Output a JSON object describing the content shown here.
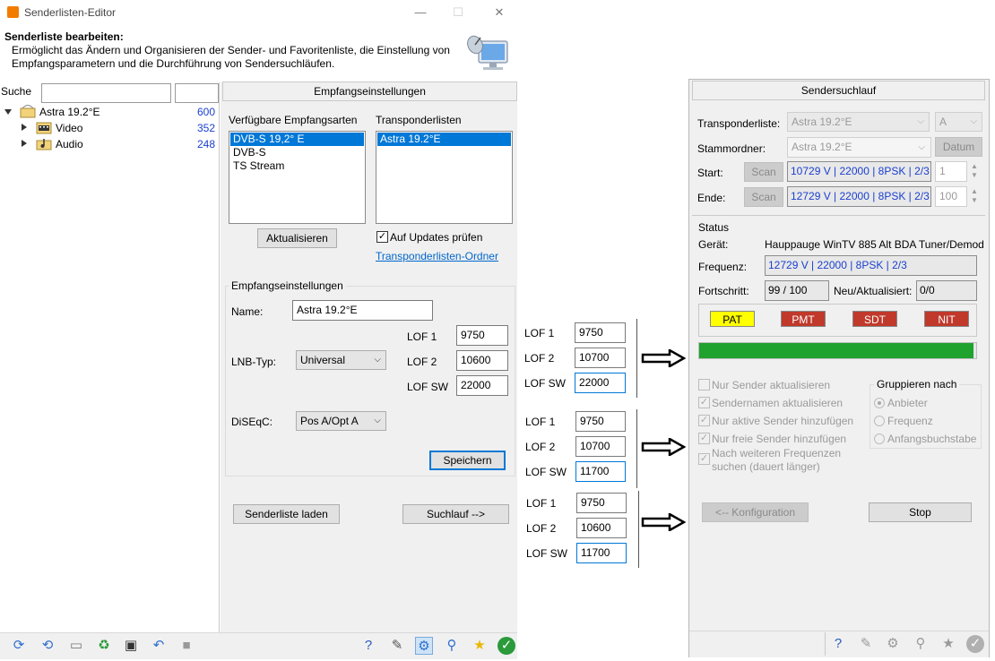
{
  "window": {
    "title": "Senderlisten-Editor",
    "minimize_glyph": "—",
    "maximize_glyph": "☐",
    "close_glyph": "✕",
    "header_title": "Senderliste bearbeiten:",
    "header_desc": "Ermöglicht das Ändern und Organisieren der Sender- und Favoritenliste, die Einstellung von Empfangsparametern und die Durchführung von Sendersuchläufen."
  },
  "left": {
    "search_label": "Suche",
    "tree": [
      {
        "label": "Astra 19.2°E",
        "count": "600"
      },
      {
        "label": "Video",
        "count": "352"
      },
      {
        "label": "Audio",
        "count": "248"
      }
    ]
  },
  "mid": {
    "panel_title": "Empfangseinstellungen",
    "available_label": "Verfügbare Empfangsarten",
    "available_items": [
      "DVB-S 19,2° E",
      "DVB-S",
      "TS Stream"
    ],
    "transponder_label": "Transponderlisten",
    "transponder_items": [
      "Astra 19.2°E"
    ],
    "refresh_button": "Aktualisieren",
    "updates_check": "Auf Updates prüfen",
    "folder_link": "Transponderlisten-Ordner",
    "group_title": "Empfangseinstellungen",
    "name_label": "Name:",
    "name_value": "Astra 19.2°E",
    "lnb_label": "LNB-Typ:",
    "lnb_value": "Universal",
    "lof1_label": "LOF 1",
    "lof1_value": "9750",
    "lof2_label": "LOF 2",
    "lof2_value": "10600",
    "lofsw_label": "LOF SW",
    "lofsw_value": "22000",
    "diseqc_label": "DiSEqC:",
    "diseqc_value": "Pos A/Opt A",
    "save_button": "Speichern",
    "load_button": "Senderliste laden",
    "scan_button": "Suchlauf -->"
  },
  "lof_panels": [
    {
      "lof1_label": "LOF 1",
      "lof1": "9750",
      "lof2_label": "LOF 2",
      "lof2": "10700",
      "lofsw_label": "LOF SW",
      "lofsw": "22000"
    },
    {
      "lof1_label": "LOF 1",
      "lof1": "9750",
      "lof2_label": "LOF 2",
      "lof2": "10700",
      "lofsw_label": "LOF SW",
      "lofsw": "11700"
    },
    {
      "lof1_label": "LOF 1",
      "lof1": "9750",
      "lof2_label": "LOF 2",
      "lof2": "10600",
      "lofsw_label": "LOF SW",
      "lofsw": "11700"
    }
  ],
  "scan": {
    "panel_title": "Sendersuchlauf",
    "transponder_label": "Transponderliste:",
    "transponder_value": "Astra 19.2°E",
    "transponder_letter": "A",
    "root_label": "Stammordner:",
    "root_value": "Astra 19.2°E",
    "date_button": "Datum",
    "start_label": "Start:",
    "end_label": "Ende:",
    "scan_button": "Scan",
    "start_value": "10729 V | 22000 | 8PSK | 2/3",
    "start_num": "1",
    "end_value": "12729 V | 22000 | 8PSK | 2/3",
    "end_num": "100",
    "status_title": "Status",
    "device_label": "Gerät:",
    "device_value": "Hauppauge WinTV 885 Alt BDA Tuner/Demod",
    "freq_label": "Frequenz:",
    "freq_value": "12729 V | 22000 | 8PSK | 2/3",
    "progress_label": "Fortschritt:",
    "progress_value": "99 / 100",
    "new_label": "Neu/Aktualisiert:",
    "new_value": "0/0",
    "progress_fraction": 0.99,
    "tables": [
      {
        "label": "PAT",
        "color": "#ffff00",
        "text_color": "#000000"
      },
      {
        "label": "PMT",
        "color": "#c0392b",
        "text_color": "#ffffff"
      },
      {
        "label": "SDT",
        "color": "#c0392b",
        "text_color": "#ffffff"
      },
      {
        "label": "NIT",
        "color": "#c0392b",
        "text_color": "#ffffff"
      }
    ],
    "options": [
      {
        "label": "Nur Sender aktualisieren",
        "checked": false
      },
      {
        "label": "Sendernamen aktualisieren",
        "checked": true
      },
      {
        "label": "Nur aktive Sender hinzufügen",
        "checked": true
      },
      {
        "label": "Nur freie Sender hinzufügen",
        "checked": true
      },
      {
        "label": "Nach weiteren Frequenzen",
        "label2": "suchen (dauert länger)",
        "checked": true
      }
    ],
    "group_title": "Gruppieren nach",
    "group_options": [
      "Anbieter",
      "Frequenz",
      "Anfangsbuchstabe"
    ],
    "config_button": "<-- Konfiguration",
    "stop_button": "Stop"
  },
  "colors": {
    "selection": "#0078d7",
    "count_blue": "#1a3fcf",
    "progress_green": "#1fa22e",
    "link": "#0066cc"
  }
}
